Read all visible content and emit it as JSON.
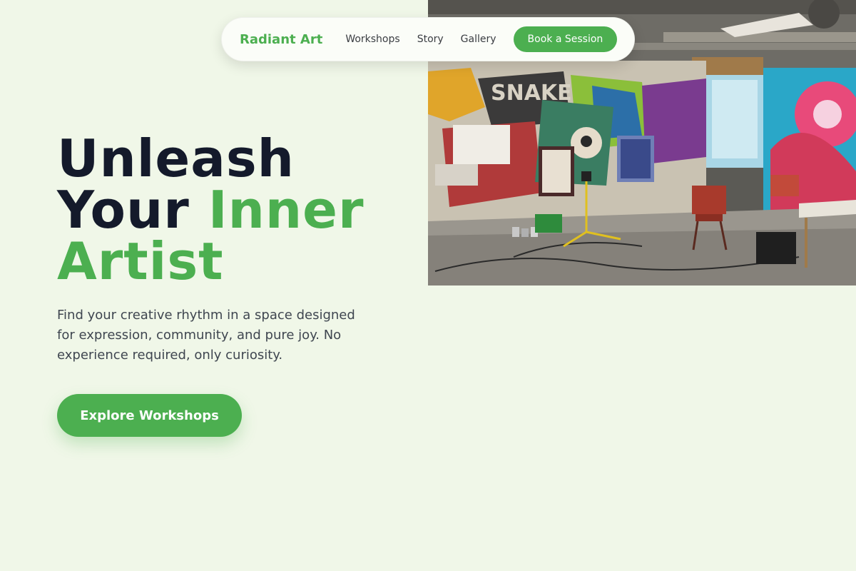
{
  "nav": {
    "brand": "Radiant Art",
    "links": [
      {
        "label": "Workshops"
      },
      {
        "label": "Story"
      },
      {
        "label": "Gallery"
      }
    ],
    "cta_label": "Book a Session"
  },
  "hero": {
    "headline_line1": "Unleash",
    "headline_line2_plain": "Your",
    "headline_line2_accent": "Inner",
    "headline_line3_accent": "Artist",
    "subtext": "Find your creative rhythm in a space designed for expression, community, and pure joy. No experience required, only curiosity.",
    "cta_label": "Explore Workshops",
    "image_subject": "graffiti-covered art studio with easels, chairs and paint supplies",
    "image_wall_lettering": "SNAKE"
  },
  "colors": {
    "background": "#f0f7e8",
    "accent": "#4caf50",
    "headline": "#141a2b",
    "body_text": "#3f4650"
  }
}
